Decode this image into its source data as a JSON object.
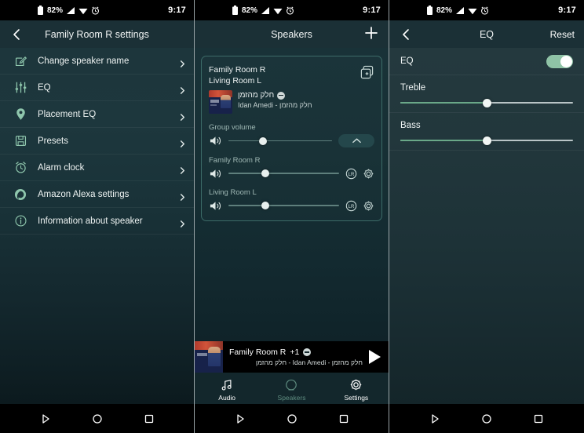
{
  "status_bar": {
    "battery": "82%",
    "time": "9:17",
    "icons": [
      "battery-icon",
      "signal-icon",
      "wifi-icon",
      "alarm-icon"
    ]
  },
  "android_nav": {
    "back_label": "back-triangle",
    "home_label": "home-circle",
    "recents_label": "recents-square"
  },
  "panel_left": {
    "appbar": {
      "title": "Family Room R settings",
      "back_icon": "chevron-left-icon"
    },
    "items": [
      {
        "label": "Change speaker name",
        "icon": "edit-square-icon"
      },
      {
        "label": "EQ",
        "icon": "equalizer-icon"
      },
      {
        "label": "Placement EQ",
        "icon": "map-pin-icon"
      },
      {
        "label": "Presets",
        "icon": "floppy-disk-icon"
      },
      {
        "label": "Alarm clock",
        "icon": "alarm-clock-icon"
      },
      {
        "label": "Amazon Alexa settings",
        "icon": "alexa-ring-icon"
      },
      {
        "label": "Information about speaker",
        "icon": "info-circle-icon"
      }
    ]
  },
  "panel_mid": {
    "appbar": {
      "title": "Speakers",
      "add_icon": "plus-icon"
    },
    "card": {
      "speaker_names": [
        "Family Room R",
        "Living Room L"
      ],
      "copy_icon": "duplicate-icon",
      "now_playing": {
        "title": "חלק מהזמן",
        "subtitle": "Idan Amedi - חלק מהזמן",
        "source_badge": "spotify-connect-icon",
        "artwork": "album-art-idan-amedi"
      },
      "group_volume_label": "Group volume",
      "group_volume": 33,
      "collapse_icon": "chevron-up-icon",
      "speakers": [
        {
          "name": "Family Room R",
          "volume": 33,
          "lr_icon": "lr-channel-icon",
          "gear_icon": "gear-icon"
        },
        {
          "name": "Living Room L",
          "volume": 33,
          "lr_icon": "lr-channel-icon",
          "gear_icon": "gear-icon"
        }
      ]
    },
    "now_playing_bar": {
      "title": "Family Room R",
      "extra_count": "+1",
      "badge": "spotify-connect-icon",
      "subtitle": "חלק מהזמן - Idan Amedi - חלק מהזמן",
      "play_icon": "play-icon"
    },
    "tabs": [
      {
        "label": "Audio",
        "icon": "music-note-icon",
        "state": "active"
      },
      {
        "label": "Speakers",
        "icon": "speaker-circle-icon",
        "state": "dim"
      },
      {
        "label": "Settings",
        "icon": "gear-icon",
        "state": "active"
      }
    ]
  },
  "panel_right": {
    "appbar": {
      "title": "EQ",
      "back_icon": "chevron-left-icon",
      "action": "Reset"
    },
    "eq_toggle": {
      "label": "EQ",
      "on": true
    },
    "sliders": [
      {
        "label": "Treble",
        "value": 50
      },
      {
        "label": "Bass",
        "value": 50
      }
    ]
  }
}
